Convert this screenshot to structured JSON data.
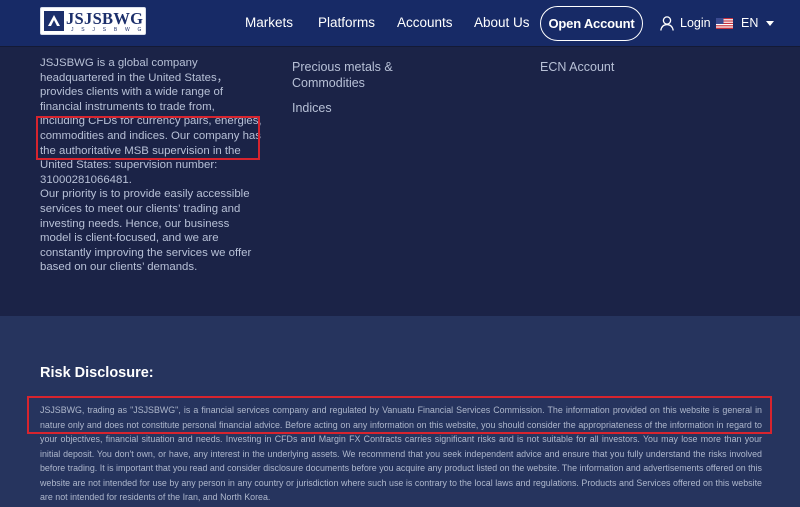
{
  "header": {
    "logo_text": "JSJSBWG",
    "logo_sub": "J S J S B W G",
    "nav": [
      "Markets",
      "Platforms",
      "Accounts",
      "About Us"
    ],
    "open_account": "Open Account",
    "login": "Login",
    "language": "EN"
  },
  "footer": {
    "about_paragraphs": [
      "JSJSBWG is a global company headquartered in the United States， provides clients with a wide range of financial instruments to trade from, including CFDs for currency pairs, energies, commodities and indices. Our company has the authoritative MSB supervision in the United States: supervision number: 31000281066481.",
      "Our priority is to provide easily accessible services to meet our clients’ trading and investing needs. Hence, our business model is client-focused, and we are constantly improving the services we offer based on our clients’ demands."
    ],
    "markets_links": [
      "Precious metals & Commodities",
      "Indices"
    ],
    "accounts_links": [
      "ECN Account"
    ]
  },
  "risk": {
    "title": "Risk Disclosure:",
    "text": "JSJSBWG, trading as \"JSJSBWG\", is a financial services company and regulated by Vanuatu Financial Services Commission. The information provided on this website is general in nature only and does not constitute personal financial advice. Before acting on any information on this website, you should consider the appropriateness of the information in regard to your objectives, financial situation and needs. Investing in CFDs and Margin FX Contracts carries significant risks and is not suitable for all investors. You may lose more than your initial deposit. You don't own, or have, any interest in the underlying assets. We recommend that you seek independent advice and ensure that you fully understand the risks involved before trading. It is important that you read and consider disclosure documents before you acquire any product listed on the website. The information and advertisements offered on this website are not intended for use by any person in any country or jurisdiction where such use is contrary to the local laws and regulations. Products and Services offered on this website are not intended for residents of the Iran, and North Korea."
  },
  "colors": {
    "header_bg": "#172a66",
    "footer_bg": "#1b2347",
    "risk_bg": "#26345e",
    "highlight": "#d7242e"
  }
}
